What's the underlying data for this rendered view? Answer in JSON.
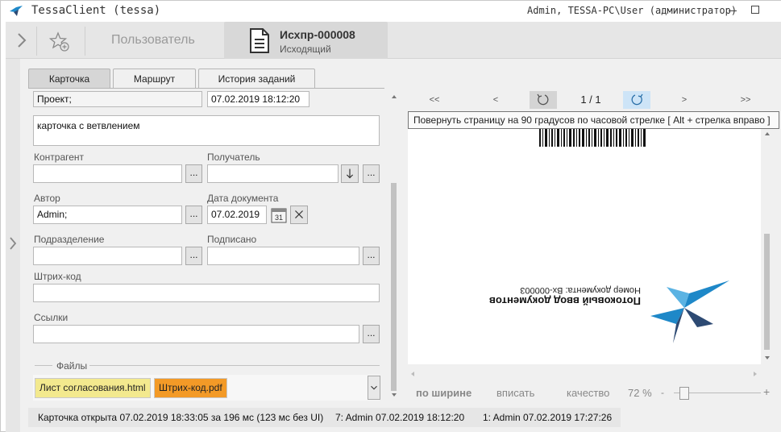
{
  "window": {
    "title": "TessaClient (tessa)",
    "user_info": "Admin, TESSA-PC\\User (администратор)"
  },
  "header": {
    "user_label": "Пользователь",
    "doc_title": "Исхпр-000008",
    "doc_subtitle": "Исходящий"
  },
  "tabs": [
    {
      "label": "Карточка",
      "active": true
    },
    {
      "label": "Маршрут",
      "active": false
    },
    {
      "label": "История заданий",
      "active": false
    }
  ],
  "form": {
    "project_value": "Проект;",
    "project_date": "07.02.2019  18:12:20",
    "subject_text": "карточка с ветвлением",
    "counterparty_label": "Контрагент",
    "counterparty_value": "",
    "recipient_label": "Получатель",
    "recipient_value": "",
    "author_label": "Автор",
    "author_value": "Admin;",
    "doc_date_label": "Дата документа",
    "doc_date_value": "07.02.2019",
    "department_label": "Подразделение",
    "department_value": "",
    "signed_label": "Подписано",
    "signed_value": "",
    "barcode_label": "Штрих-код",
    "barcode_value": "",
    "links_label": "Ссылки",
    "links_value": "",
    "files_label": "Файлы",
    "dots_label": "...",
    "files": [
      {
        "name": "Лист согласования.html",
        "color": "#f3e98e"
      },
      {
        "name": "Штрих-код.pdf",
        "color": "#f39a27"
      }
    ]
  },
  "viewer": {
    "first_label": "<<",
    "prev_label": "<",
    "page_indicator": "1 / 1",
    "next_label": ">",
    "last_label": ">>",
    "tooltip": "Повернуть страницу на 90 градусов по часовой стрелке    [ Alt + стрелка вправо ]",
    "doc_heading": "Потоковый ввод документов",
    "doc_number": "Номер документа: Вх-000003",
    "fit_width_label": "по ширине",
    "fit_label": "вписать",
    "quality_label": "качество",
    "zoom_value": "72 %",
    "zoom_minus": "-",
    "zoom_plus": "+"
  },
  "status_bar": {
    "card_opened": "Карточка открыта 07.02.2019 18:33:05 за 196 мс (123 мс без UI)",
    "entry1": "7:  Admin  07.02.2019 18:12:20",
    "entry2": "1:  Admin  07.02.2019 17:27:26"
  },
  "colors": {
    "logo_blue": "#1e88c8",
    "logo_dark": "#2d4a73",
    "chip_yellow": "#f3e98e",
    "chip_orange": "#f39a27",
    "rotate_highlight": "#cde4f7"
  }
}
